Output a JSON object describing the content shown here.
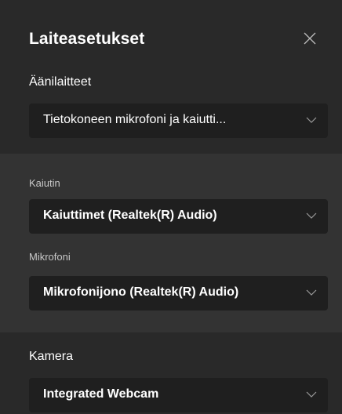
{
  "header": {
    "title": "Laiteasetukset"
  },
  "audio_devices": {
    "label": "Äänilaitteet",
    "selected": "Tietokoneen mikrofoni ja kaiutti..."
  },
  "speaker": {
    "label": "Kaiutin",
    "selected": "Kaiuttimet (Realtek(R) Audio)"
  },
  "microphone": {
    "label": "Mikrofoni",
    "selected": "Mikrofonijono (Realtek(R) Audio)"
  },
  "camera": {
    "label": "Kamera",
    "selected": "Integrated Webcam"
  },
  "icons": {
    "close": "close-icon",
    "dropdown": "chevron-down-icon"
  },
  "colors": {
    "background": "#292929",
    "device_section": "#333333",
    "dropdown": "#1f1f1f",
    "text": "#ffffff"
  }
}
